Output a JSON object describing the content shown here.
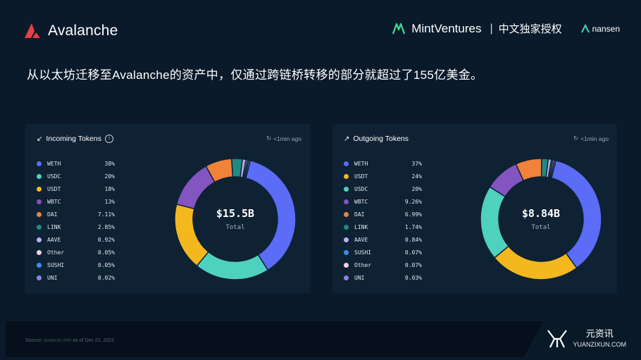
{
  "header": {
    "brand": "Avalanche",
    "partner": "MintVentures",
    "license": "中文独家授权",
    "partner2": "nansen"
  },
  "headline": "从以太坊迁移至Avalanche的资产中，仅通过跨链桥转移的部分就超过了155亿美金。",
  "colors": {
    "WETH": "#5b6cf6",
    "USDC": "#4fd1c0",
    "USDT": "#f2b81e",
    "WBTC": "#8454c0",
    "DAI": "#f0823a",
    "LINK": "#1f8a82",
    "AAVE": "#b9b1f0",
    "Other": "#f7cfe2",
    "SUSHI": "#3b8ff0",
    "UNI": "#8f80f0"
  },
  "incoming": {
    "title": "Incoming Tokens",
    "updated": "<1min ago",
    "total_value": "$15.5B",
    "total_label": "Total",
    "rows": [
      {
        "token": "WETH",
        "pct": "38%"
      },
      {
        "token": "USDC",
        "pct": "20%"
      },
      {
        "token": "USDT",
        "pct": "18%"
      },
      {
        "token": "WBTC",
        "pct": "13%"
      },
      {
        "token": "DAI",
        "pct": "7.11%"
      },
      {
        "token": "LINK",
        "pct": "2.85%"
      },
      {
        "token": "AAVE",
        "pct": "0.92%"
      },
      {
        "token": "Other",
        "pct": "0.05%"
      },
      {
        "token": "SUSHI",
        "pct": "0.05%"
      },
      {
        "token": "UNI",
        "pct": "0.02%"
      }
    ]
  },
  "outgoing": {
    "title": "Outgoing Tokens",
    "updated": "<1min ago",
    "total_value": "$8.84B",
    "total_label": "Total",
    "rows": [
      {
        "token": "WETH",
        "pct": "37%"
      },
      {
        "token": "USDT",
        "pct": "24%"
      },
      {
        "token": "USDC",
        "pct": "20%"
      },
      {
        "token": "WBTC",
        "pct": "9.26%"
      },
      {
        "token": "DAI",
        "pct": "6.99%"
      },
      {
        "token": "LINK",
        "pct": "1.74%"
      },
      {
        "token": "AAVE",
        "pct": "0.84%"
      },
      {
        "token": "SUSHI",
        "pct": "0.07%"
      },
      {
        "token": "Other",
        "pct": "0.07%"
      },
      {
        "token": "UNI",
        "pct": "0.03%"
      }
    ]
  },
  "chart_data": [
    {
      "type": "pie",
      "title": "Incoming Tokens",
      "categories": [
        "WETH",
        "USDC",
        "USDT",
        "WBTC",
        "DAI",
        "LINK",
        "AAVE",
        "Other",
        "SUSHI",
        "UNI"
      ],
      "values": [
        38,
        20,
        18,
        13,
        7.11,
        2.85,
        0.92,
        0.05,
        0.05,
        0.02
      ],
      "total": "$15.5B"
    },
    {
      "type": "pie",
      "title": "Outgoing Tokens",
      "categories": [
        "WETH",
        "USDT",
        "USDC",
        "WBTC",
        "DAI",
        "LINK",
        "AAVE",
        "SUSHI",
        "Other",
        "UNI"
      ],
      "values": [
        37,
        24,
        20,
        9.26,
        6.99,
        1.74,
        0.84,
        0.07,
        0.07,
        0.03
      ],
      "total": "$8.84B"
    }
  ],
  "footer": {
    "source_prefix": "Source:",
    "source_link": "avascan.info",
    "source_suffix": "as of Dec 21, 2021",
    "watermark_cn": "元资讯",
    "watermark_en": "YUANZIXUN.COM"
  }
}
